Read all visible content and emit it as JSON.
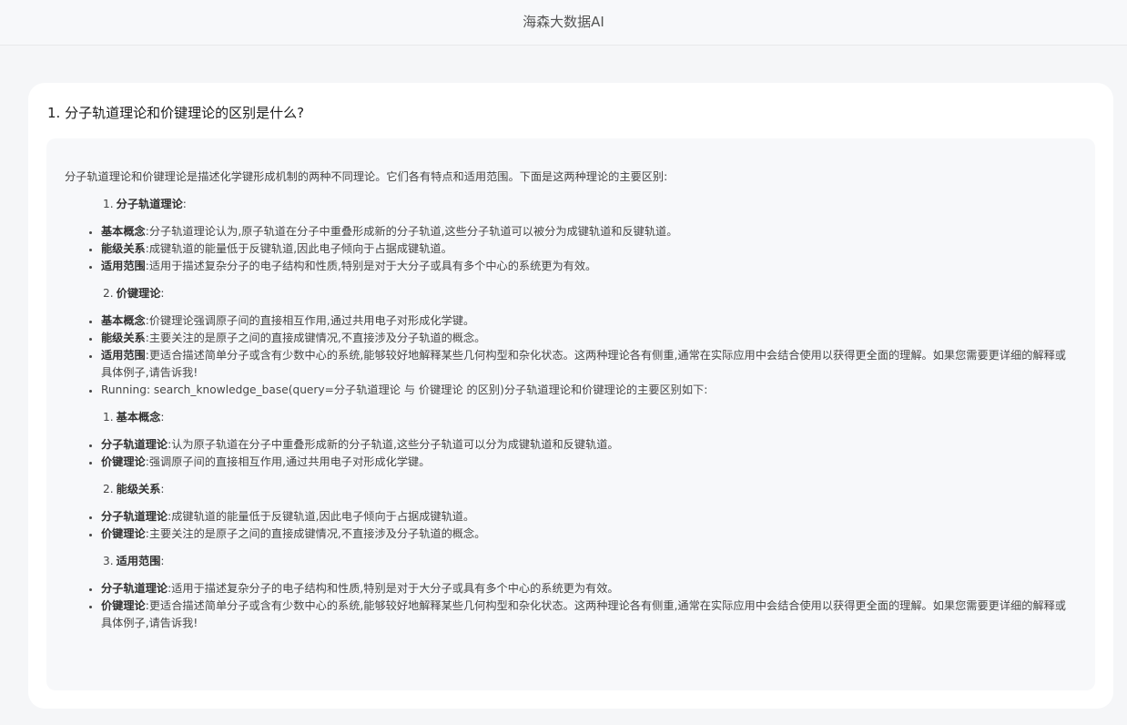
{
  "header": {
    "title": "海森大数据AI"
  },
  "question": {
    "text": "1. 分子轨道理论和价键理论的区别是什么?"
  },
  "answer": {
    "intro": "分子轨道理论和价键理论是描述化学键形成机制的两种不同理论。它们各有特点和适用范围。下面是这两种理论的主要区别:",
    "mo": {
      "num": "1.",
      "heading": "分子轨道理论",
      "colon": ":",
      "points": [
        {
          "label": "基本概念",
          "text": ":分子轨道理论认为,原子轨道在分子中重叠形成新的分子轨道,这些分子轨道可以被分为成键轨道和反键轨道。"
        },
        {
          "label": "能级关系",
          "text": ":成键轨道的能量低于反键轨道,因此电子倾向于占据成键轨道。"
        },
        {
          "label": "适用范围",
          "text": ":适用于描述复杂分子的电子结构和性质,特别是对于大分子或具有多个中心的系统更为有效。"
        }
      ]
    },
    "vb": {
      "num": "2.",
      "heading": "价键理论",
      "colon": ":",
      "points": [
        {
          "label": "基本概念",
          "text": ":价键理论强调原子间的直接相互作用,通过共用电子对形成化学键。"
        },
        {
          "label": "能级关系",
          "text": ":主要关注的是原子之间的直接成键情况,不直接涉及分子轨道的概念。"
        },
        {
          "label": "适用范围",
          "text": ":更适合描述简单分子或含有少数中心的系统,能够较好地解释某些几何构型和杂化状态。这两种理论各有侧重,通常在实际应用中会结合使用以获得更全面的理解。如果您需要更详细的解释或具体例子,请告诉我!"
        }
      ],
      "running": "Running: search_knowledge_base(query=分子轨道理论 与 价键理论 的区别)分子轨道理论和价键理论的主要区别如下:"
    },
    "summary": [
      {
        "num": "1.",
        "heading": "基本概念",
        "colon": ":",
        "points": [
          {
            "label": "分子轨道理论",
            "text": ":认为原子轨道在分子中重叠形成新的分子轨道,这些分子轨道可以分为成键轨道和反键轨道。"
          },
          {
            "label": "价键理论",
            "text": ":强调原子间的直接相互作用,通过共用电子对形成化学键。"
          }
        ]
      },
      {
        "num": "2.",
        "heading": "能级关系",
        "colon": ":",
        "points": [
          {
            "label": "分子轨道理论",
            "text": ":成键轨道的能量低于反键轨道,因此电子倾向于占据成键轨道。"
          },
          {
            "label": "价键理论",
            "text": ":主要关注的是原子之间的直接成键情况,不直接涉及分子轨道的概念。"
          }
        ]
      },
      {
        "num": "3.",
        "heading": "适用范围",
        "colon": ":",
        "points": [
          {
            "label": "分子轨道理论",
            "text": ":适用于描述复杂分子的电子结构和性质,特别是对于大分子或具有多个中心的系统更为有效。"
          },
          {
            "label": "价键理论",
            "text": ":更适合描述简单分子或含有少数中心的系统,能够较好地解释某些几何构型和杂化状态。这两种理论各有侧重,通常在实际应用中会结合使用以获得更全面的理解。如果您需要更详细的解释或具体例子,请告诉我!"
          }
        ]
      }
    ]
  }
}
